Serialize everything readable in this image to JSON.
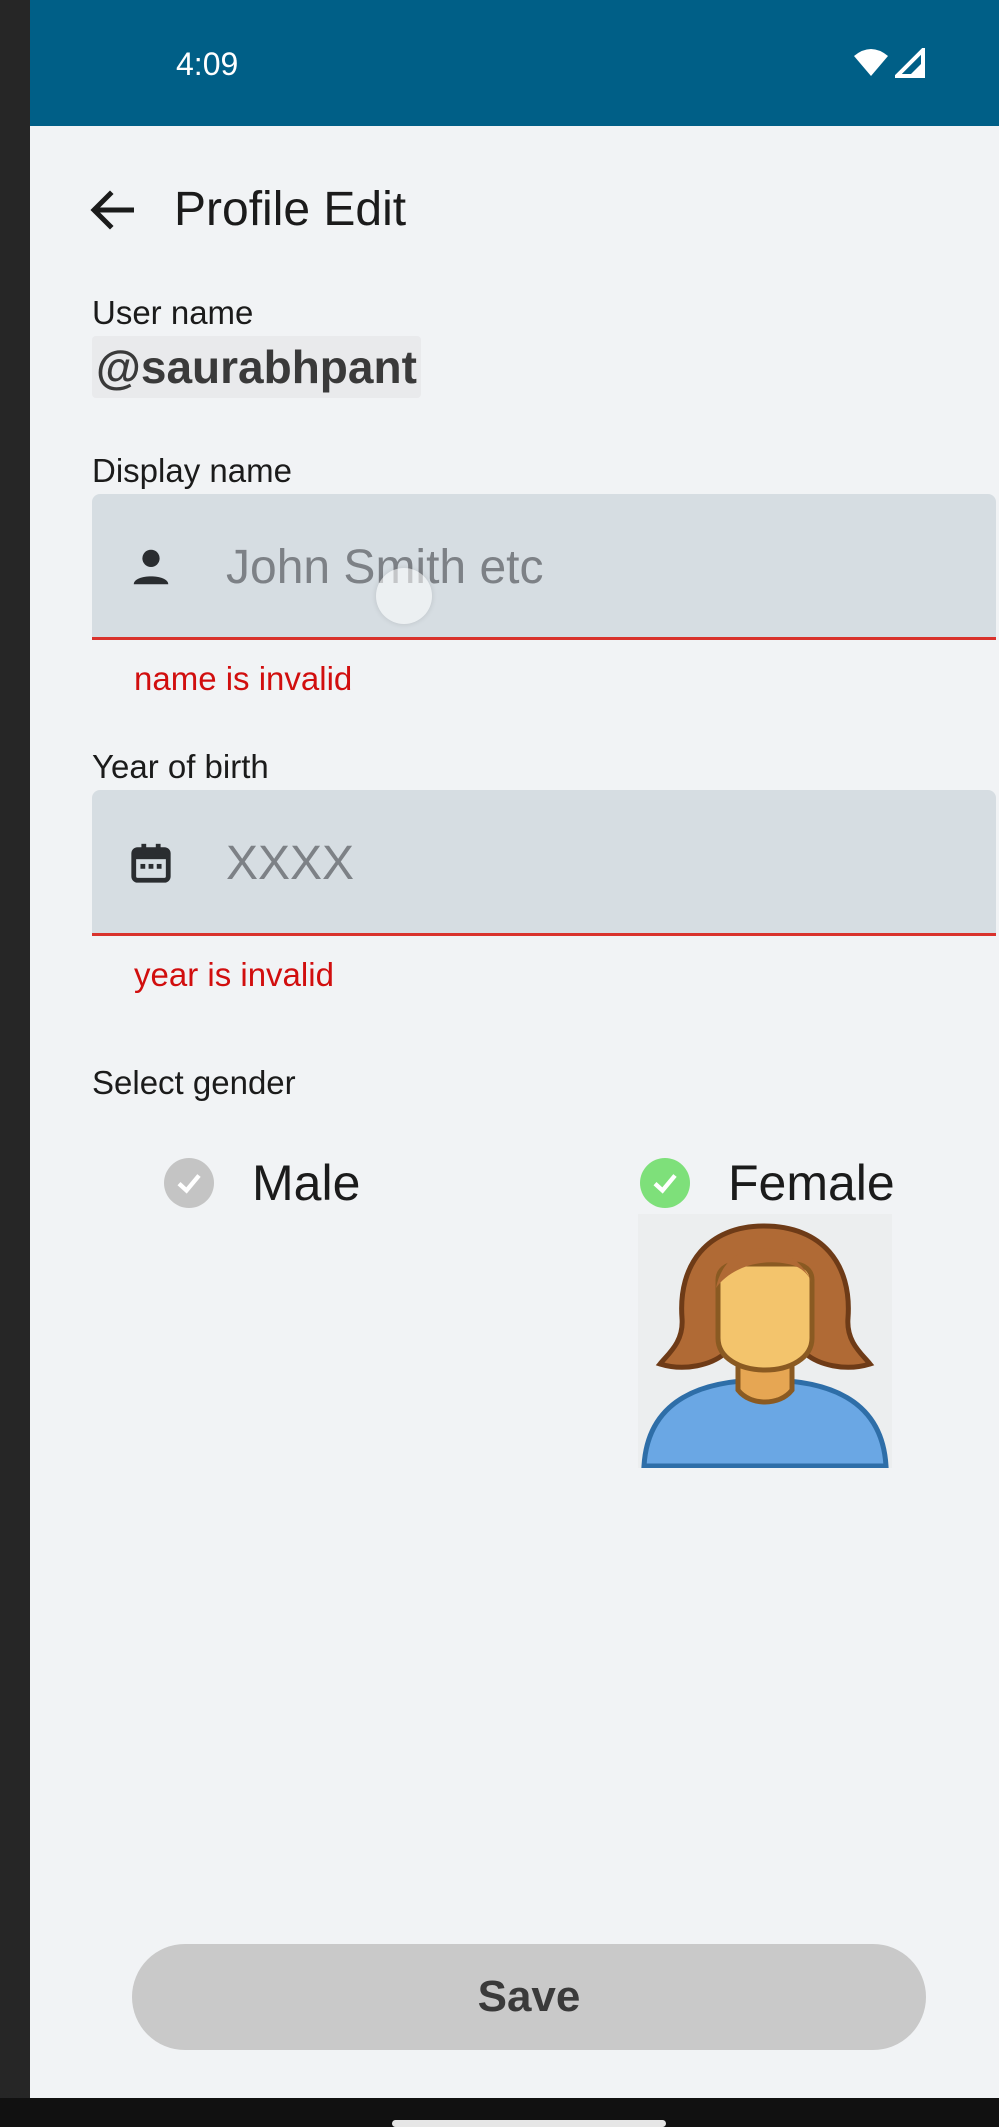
{
  "status_bar": {
    "time": "4:09"
  },
  "header": {
    "title": "Profile Edit"
  },
  "username": {
    "label": "User name",
    "value": "@saurabhpant"
  },
  "display_name": {
    "label": "Display name",
    "placeholder": "John Smith etc",
    "error": "name is invalid"
  },
  "year_of_birth": {
    "label": "Year of birth",
    "placeholder": "XXXX",
    "error": "year is invalid"
  },
  "gender": {
    "label": "Select gender",
    "options": [
      {
        "label": "Male",
        "selected": false
      },
      {
        "label": "Female",
        "selected": true
      }
    ]
  },
  "save_button": {
    "label": "Save"
  },
  "icons": {
    "back": "arrow-left-icon",
    "person": "person-icon",
    "calendar": "calendar-icon",
    "wifi": "wifi-icon",
    "signal": "signal-icon",
    "check": "check-circle-icon",
    "avatar": "female-avatar-icon"
  },
  "colors": {
    "status_bar": "#005f87",
    "error": "#d10e0e",
    "selected_check": "#7ee07a",
    "unselected_check": "#c4c4c4",
    "input_background": "#d6dde2",
    "save_button": "#c9c9c9"
  }
}
